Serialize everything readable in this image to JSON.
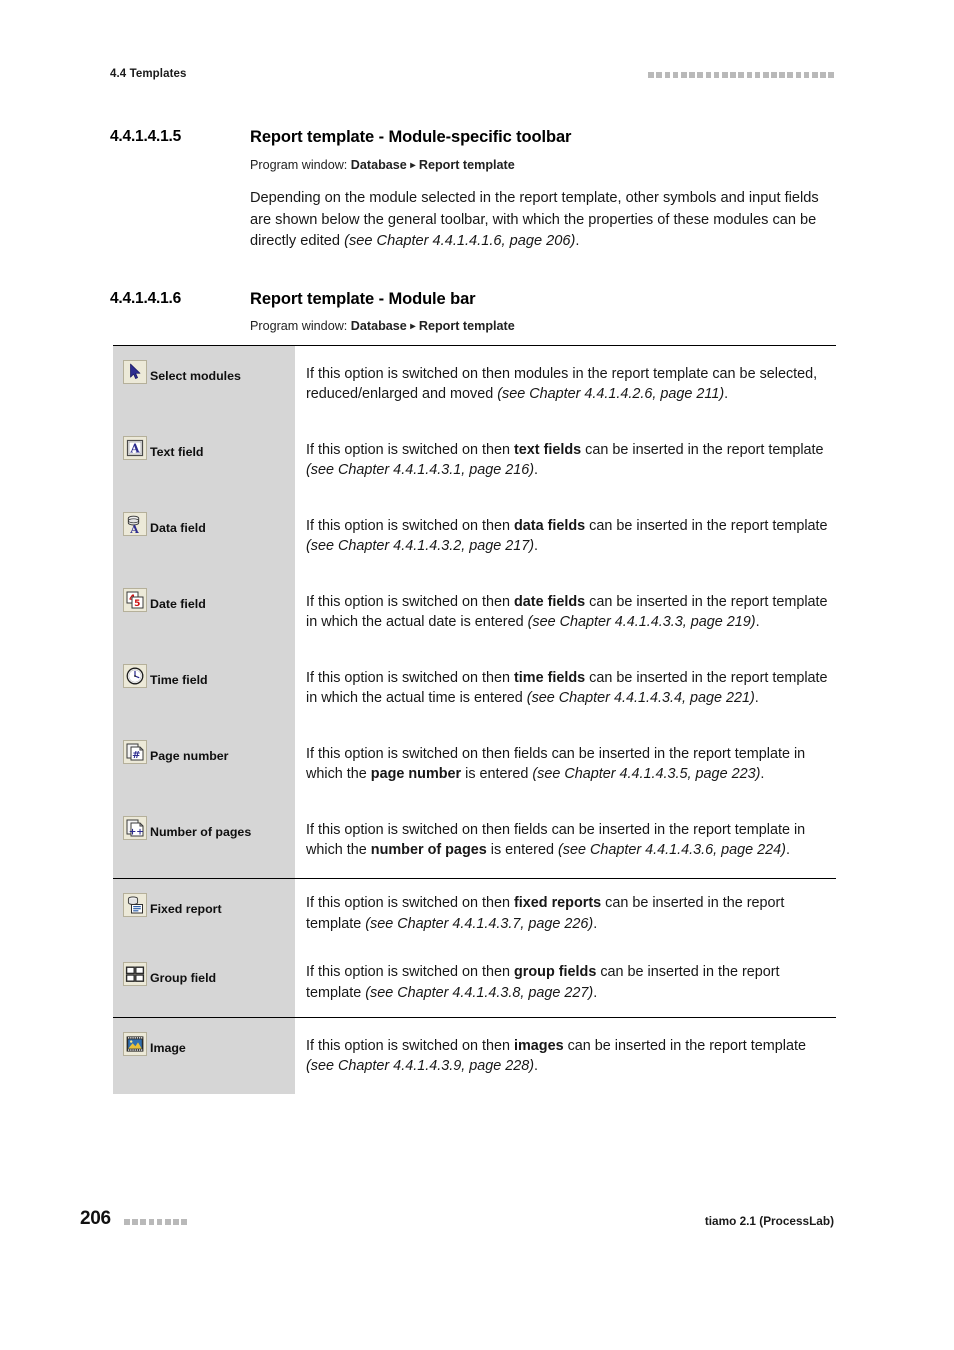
{
  "header": {
    "section_label": "4.4 Templates",
    "marker_squares": 23,
    "marker_color": "#b9b9b9"
  },
  "sections": [
    {
      "number": "4.4.1.4.1.5",
      "title": "Report template - Module-specific toolbar",
      "program_window_label": "Program window:",
      "program_window_path_1": "Database",
      "program_window_arrow": "▸",
      "program_window_path_2": "Report template",
      "paragraph_plain_1": "Depending on the module selected in the report template, other symbols and input fields are shown below the general toolbar, with which the properties of these modules can be directly edited ",
      "paragraph_italic": "(see Chapter 4.4.1.4.1.6, page 206)",
      "paragraph_plain_2": "."
    },
    {
      "number": "4.4.1.4.1.6",
      "title": "Report template - Module bar",
      "program_window_label": "Program window:",
      "program_window_path_1": "Database",
      "program_window_arrow": "▸",
      "program_window_path_2": "Report template"
    }
  ],
  "table": {
    "rows": [
      {
        "icon": "cursor-arrow-icon",
        "label": "Select modules",
        "separator_above": false,
        "desc_pre": "If this option is switched on then modules in the report template can be selected, reduced/enlarged and moved ",
        "desc_bold": "",
        "desc_mid": "",
        "desc_italic": "(see Chapter 4.4.1.4.2.6, page 211)",
        "desc_post": "."
      },
      {
        "icon": "text-field-icon",
        "label": "Text field",
        "separator_above": false,
        "desc_pre": "If this option is switched on then ",
        "desc_bold": "text fields",
        "desc_mid": " can be inserted in the report template ",
        "desc_italic": "(see Chapter 4.4.1.4.3.1, page 216)",
        "desc_post": "."
      },
      {
        "icon": "data-field-icon",
        "label": "Data field",
        "separator_above": false,
        "desc_pre": "If this option is switched on then ",
        "desc_bold": "data fields",
        "desc_mid": " can be inserted in the report template ",
        "desc_italic": "(see Chapter 4.4.1.4.3.2, page 217)",
        "desc_post": "."
      },
      {
        "icon": "date-field-icon",
        "label": "Date field",
        "separator_above": false,
        "desc_pre": "If this option is switched on then ",
        "desc_bold": "date fields",
        "desc_mid": " can be inserted in the report template in which the actual date is entered ",
        "desc_italic": "(see Chapter 4.4.1.4.3.3, page 219)",
        "desc_post": "."
      },
      {
        "icon": "time-field-icon",
        "label": "Time field",
        "separator_above": false,
        "desc_pre": "If this option is switched on then ",
        "desc_bold": "time fields",
        "desc_mid": " can be inserted in the report template in which the actual time is entered ",
        "desc_italic": "(see Chapter 4.4.1.4.3.4, page 221)",
        "desc_post": "."
      },
      {
        "icon": "page-number-icon",
        "label": "Page number",
        "separator_above": false,
        "desc_pre": "If this option is switched on then fields can be inserted in the report template in which the ",
        "desc_bold": "page number",
        "desc_mid": " is entered ",
        "desc_italic": "(see Chapter 4.4.1.4.3.5, page 223)",
        "desc_post": "."
      },
      {
        "icon": "number-of-pages-icon",
        "label": "Number of pages",
        "separator_above": false,
        "desc_pre": "If this option is switched on then fields can be inserted in the report template in which the ",
        "desc_bold": "number of pages",
        "desc_mid": " is entered ",
        "desc_italic": "(see Chapter 4.4.1.4.3.6, page 224)",
        "desc_post": "."
      },
      {
        "icon": "fixed-report-icon",
        "label": "Fixed report",
        "separator_above": true,
        "desc_pre": "If this option is switched on then ",
        "desc_bold": "fixed reports",
        "desc_mid": " can be inserted in the report template ",
        "desc_italic": "(see Chapter 4.4.1.4.3.7, page 226)",
        "desc_post": "."
      },
      {
        "icon": "group-field-icon",
        "label": "Group field",
        "separator_above": false,
        "desc_pre": "If this option is switched on then ",
        "desc_bold": "group fields",
        "desc_mid": " can be inserted in the report template ",
        "desc_italic": "(see Chapter 4.4.1.4.3.8, page 227)",
        "desc_post": "."
      },
      {
        "icon": "image-icon",
        "label": "Image",
        "separator_above": true,
        "desc_pre": "If this option is switched on then ",
        "desc_bold": "images",
        "desc_mid": " can be inserted in the report template ",
        "desc_italic": "(see Chapter 4.4.1.4.3.9, page 228)",
        "desc_post": "."
      }
    ]
  },
  "footer": {
    "page_number": "206",
    "marker_squares": 8,
    "product": "tiamo 2.1 (ProcessLab)"
  }
}
